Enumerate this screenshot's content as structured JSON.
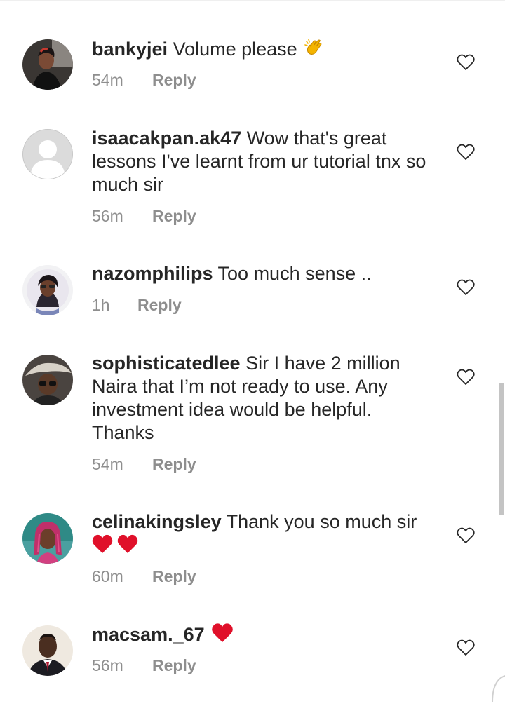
{
  "comments": [
    {
      "username": "bankyjei",
      "text": "Volume please",
      "emoji": "clapping-hands",
      "time": "54m",
      "reply": "Reply",
      "avatar_icon": "profile-photo"
    },
    {
      "username": "isaacakpan.ak47",
      "text": "Wow that's great lessons I've learnt from ur tutorial tnx so much sir",
      "time": "56m",
      "reply": "Reply",
      "avatar_icon": "default-profile-icon"
    },
    {
      "username": "nazomphilips",
      "text": "Too much sense ..",
      "time": "1h",
      "reply": "Reply",
      "avatar_icon": "profile-photo"
    },
    {
      "username": "sophisticatedlee",
      "text": "Sir I have 2 million Naira that I’m not ready to use. Any investment idea would be helpful. Thanks",
      "time": "54m",
      "reply": "Reply",
      "avatar_icon": "profile-photo"
    },
    {
      "username": "celinakingsley",
      "text": "Thank you so much sir",
      "emoji": "two-red-hearts",
      "time": "60m",
      "reply": "Reply",
      "avatar_icon": "profile-photo"
    },
    {
      "username": "macsam._67",
      "text": "",
      "emoji": "red-heart",
      "time": "56m",
      "reply": "Reply",
      "avatar_icon": "profile-photo"
    }
  ],
  "colors": {
    "text": "#262626",
    "secondary": "#8e8e8e",
    "heart_emoji": "#e0102a",
    "scrollbar": "#c4c4c4"
  }
}
